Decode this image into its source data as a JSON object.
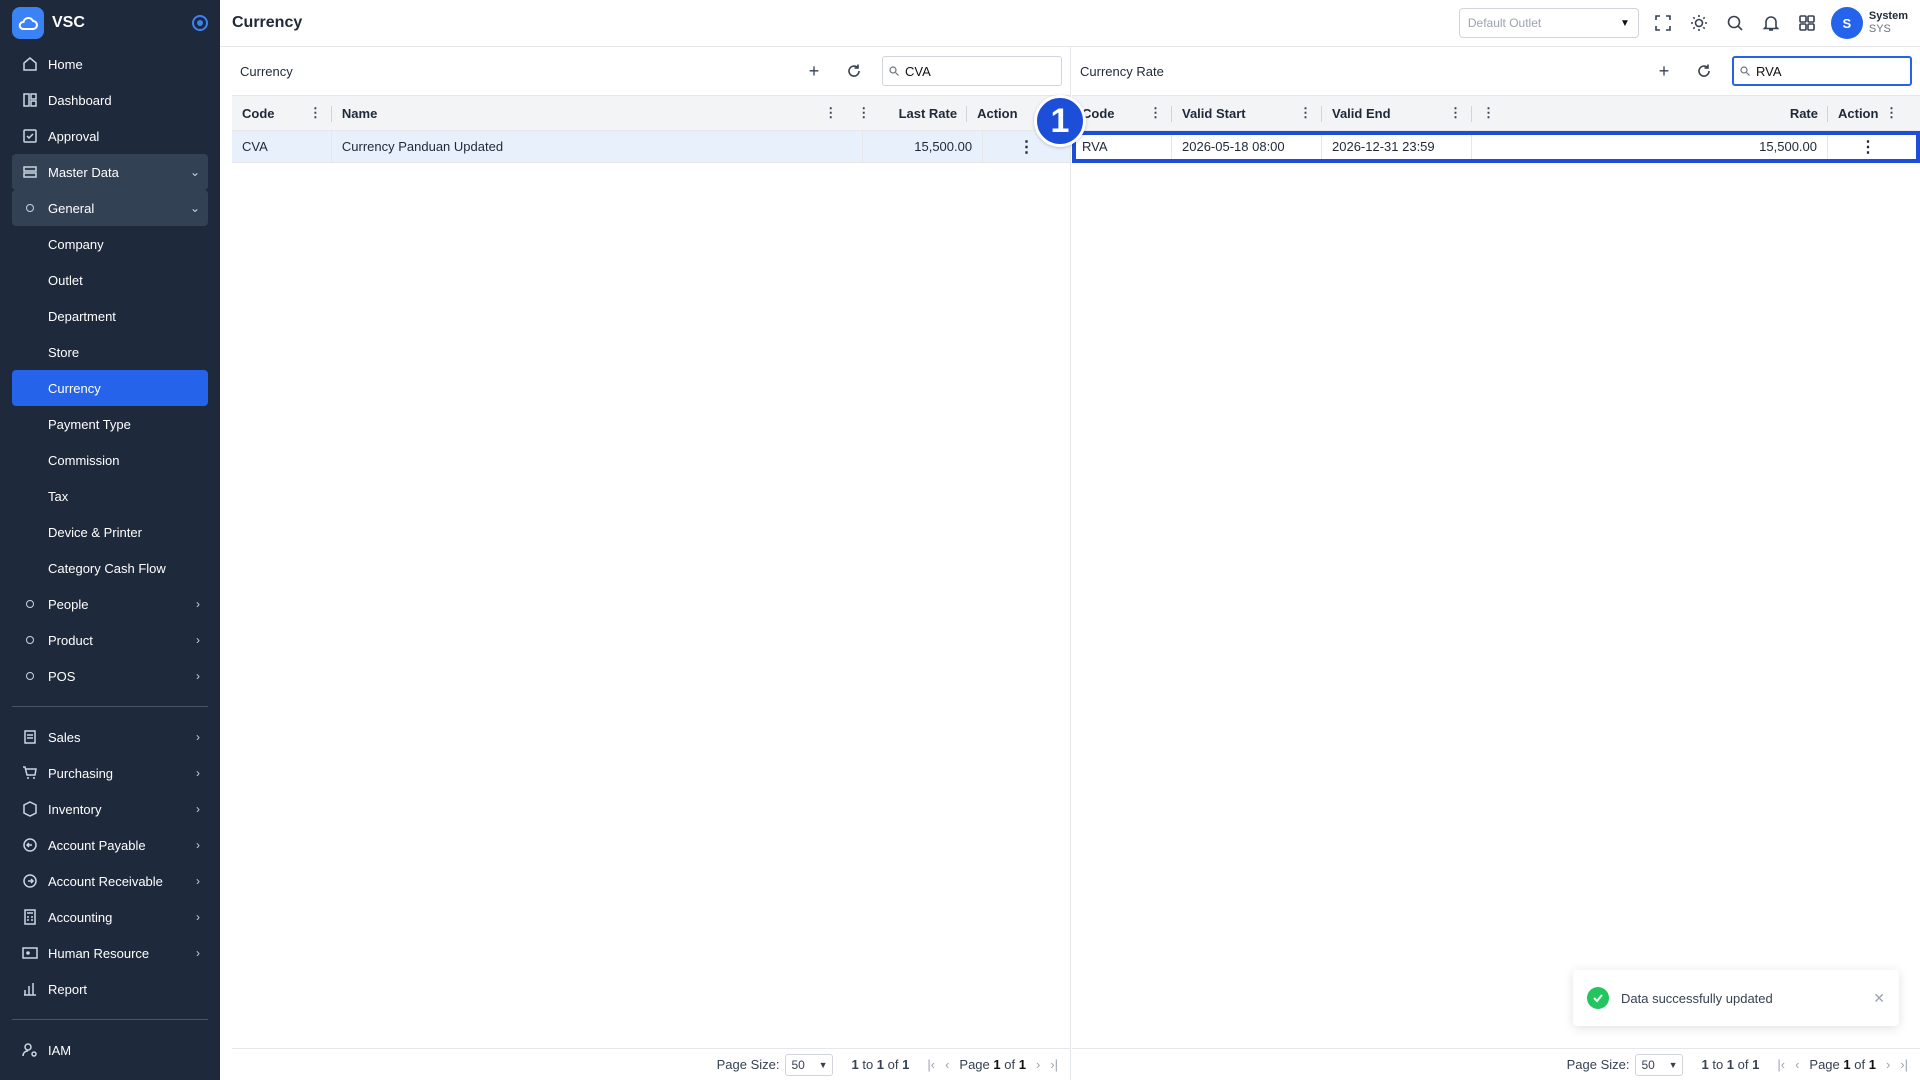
{
  "app": {
    "brand": "VSC",
    "page_title": "Currency"
  },
  "topbar": {
    "outlet_placeholder": "Default Outlet",
    "icons": [
      "fullscreen-icon",
      "theme-sun-icon",
      "search-icon",
      "bell-icon",
      "apps-grid-icon"
    ],
    "user": {
      "initial": "S",
      "name": "System",
      "code": "SYS"
    }
  },
  "sidebar": {
    "top": [
      {
        "label": "Home",
        "icon": "home-icon"
      },
      {
        "label": "Dashboard",
        "icon": "dashboard-icon"
      },
      {
        "label": "Approval",
        "icon": "approval-icon"
      }
    ],
    "master_data": "Master Data",
    "general": "General",
    "general_items": [
      "Company",
      "Outlet",
      "Department",
      "Store",
      "Currency",
      "Payment Type",
      "Commission",
      "Tax",
      "Device & Printer",
      "Category Cash Flow"
    ],
    "active_item": "Currency",
    "groups": [
      "People",
      "Product",
      "POS"
    ],
    "modules": [
      {
        "label": "Sales",
        "icon": "sales-icon"
      },
      {
        "label": "Purchasing",
        "icon": "cart-icon"
      },
      {
        "label": "Inventory",
        "icon": "box-icon"
      },
      {
        "label": "Account Payable",
        "icon": "payable-icon"
      },
      {
        "label": "Account Receivable",
        "icon": "receivable-icon"
      },
      {
        "label": "Accounting",
        "icon": "calculator-icon"
      },
      {
        "label": "Human Resource",
        "icon": "id-card-icon"
      },
      {
        "label": "Report",
        "icon": "report-icon"
      }
    ],
    "iam": "IAM"
  },
  "currency_panel": {
    "title": "Currency",
    "search_value": "CVA",
    "columns": {
      "code": "Code",
      "name": "Name",
      "last_rate": "Last Rate",
      "action": "Action"
    },
    "rows": [
      {
        "code": "CVA",
        "name": "Currency Panduan Updated",
        "last_rate": "15,500.00"
      }
    ],
    "footer": {
      "page_size_label": "Page Size:",
      "page_size": "50",
      "range_start": "1",
      "range_end": "1",
      "total": "1",
      "page": "1",
      "pages": "1"
    }
  },
  "rate_panel": {
    "title": "Currency Rate",
    "search_value": "RVA",
    "columns": {
      "code": "Code",
      "valid_start": "Valid Start",
      "valid_end": "Valid End",
      "rate": "Rate",
      "action": "Action"
    },
    "rows": [
      {
        "code": "RVA",
        "valid_start": "2026-05-18 08:00",
        "valid_end": "2026-12-31 23:59",
        "rate": "15,500.00"
      }
    ],
    "footer": {
      "page_size_label": "Page Size:",
      "page_size": "50",
      "range_start": "1",
      "range_end": "1",
      "total": "1",
      "page": "1",
      "pages": "1"
    }
  },
  "step_badge": "1",
  "toast": {
    "message": "Data successfully updated"
  },
  "colors": {
    "sidebar_bg": "#1e293b",
    "active": "#2563eb",
    "highlight": "#1d4ed8",
    "success": "#22c55e"
  }
}
